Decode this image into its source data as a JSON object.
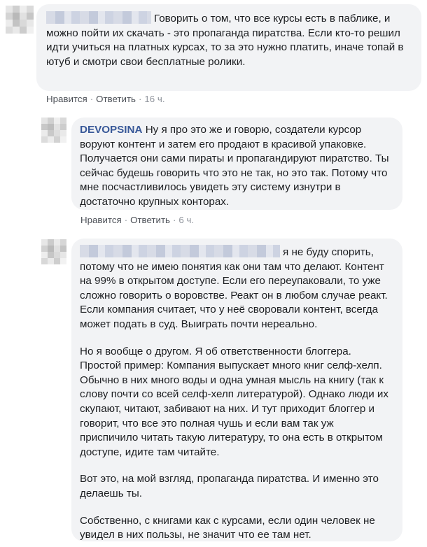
{
  "comments": [
    {
      "author": "",
      "text": "Говорить о том, что все курсы есть в паблике, и можно пойти их скачать - это пропаганда пиратства. Если кто-то решил идти учиться на платных курсах, то за это нужно платить, иначе топай в ютуб и смотри свои бесплатные ролики.",
      "like_label": "Нравится",
      "reply_label": "Ответить",
      "time": "16 ч."
    },
    {
      "author": "DEVOPSINA",
      "text": "Ну я про это же и говорю, создатели курсор воруют контент и затем его продают в красивой упаковке. Получается они сами пираты и пропагандируют пиратство. Ты сейчас будешь говорить что это не так, но это так. Потому что мне посчастливилось увидеть эту систему изнутри в достаточно крупных конторах.",
      "like_label": "Нравится",
      "reply_label": "Ответить",
      "time": "6 ч."
    },
    {
      "author": "",
      "paragraphs": [
        "я не буду спорить, потому что не имею понятия как они там что делают. Контент на 99% в открытом доступе. Если его переупаковали, то уже сложно говорить о воровстве. Реакт он в любом случае реакт. Если компания считает, что у неё своровали контент, всегда может подать в суд. Выиграть почти нереально.",
        "Но я вообще о другом. Я об ответственности блоггера. Простой пример: Компания выпускает много книг селф-хелп. Обычно в них много воды и одна умная мысль на книгу (так к слову почти со всей селф-хелп литературой). Однако люди их скупают, читают, забивают на них. И тут приходит блоггер и говорит, что все это полная чушь и если вам так уж приспичило читать такую литературу, то она есть в открытом доступе, идите там читайте.",
        "Вот это, на мой взгляд, пропаганда пиратства. И именно это делаешь ты.",
        "Собственно, с книгами как с курсами, если один человек не увидел в них пользы, не значит что ее там нет."
      ]
    }
  ]
}
